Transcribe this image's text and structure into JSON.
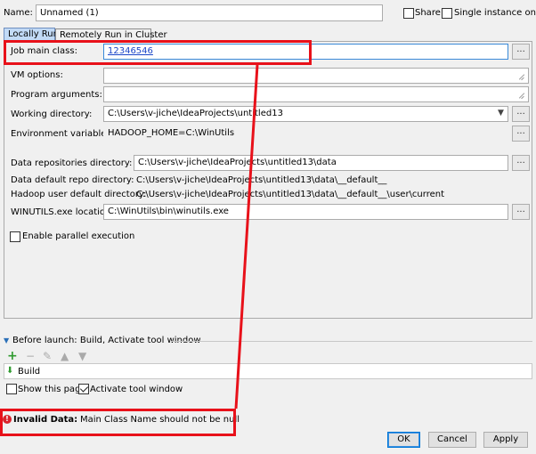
{
  "header": {
    "name_label": "Name:",
    "name_value": "Unnamed (1)",
    "share_label": "Share",
    "single_instance_label": "Single instance only"
  },
  "tabs": [
    {
      "label": "Locally Run",
      "active": true
    },
    {
      "label": "Remotely Run in Cluster",
      "active": false
    }
  ],
  "form": {
    "job_main_class": {
      "label": "Job main class:",
      "value": "12346546"
    },
    "vm_options": {
      "label": "VM options:",
      "value": ""
    },
    "program_arguments": {
      "label": "Program arguments:",
      "value": ""
    },
    "working_directory": {
      "label": "Working directory:",
      "value": "C:\\Users\\v-jiche\\IdeaProjects\\untitled13"
    },
    "environment_variables": {
      "label": "Environment variables:",
      "value": "HADOOP_HOME=C:\\WinUtils"
    },
    "data_repo_dir": {
      "label": "Data repositories directory:",
      "value": "C:\\Users\\v-jiche\\IdeaProjects\\untitled13\\data"
    },
    "data_default_repo_dir": {
      "label": "Data default repo directory:",
      "value": "C:\\Users\\v-jiche\\IdeaProjects\\untitled13\\data\\__default__"
    },
    "hadoop_user_default_dir": {
      "label": "Hadoop user default directory:",
      "value": "C:\\Users\\v-jiche\\IdeaProjects\\untitled13\\data\\__default__\\user\\current"
    },
    "winutils_location": {
      "label": "WINUTILS.exe location:",
      "value": "C:\\WinUtils\\bin\\winutils.exe"
    },
    "enable_parallel": {
      "label": "Enable parallel execution",
      "checked": false
    },
    "browse_label": "..."
  },
  "before_launch": {
    "title": "Before launch: Build, Activate tool window",
    "items": [
      "Build"
    ],
    "show_page_label": "Show this page",
    "show_page_checked": false,
    "activate_tool_window_label": "Activate tool window",
    "activate_tool_window_checked": true
  },
  "error": {
    "prefix": "Invalid Data:",
    "message": "Main Class Name should not be null",
    "color": "#e8111a"
  },
  "buttons": {
    "ok": "OK",
    "cancel": "Cancel",
    "apply": "Apply"
  },
  "colors": {
    "accent": "#0078d7",
    "annotation_red": "#e8111a",
    "active_tab": "#c2daf6"
  }
}
